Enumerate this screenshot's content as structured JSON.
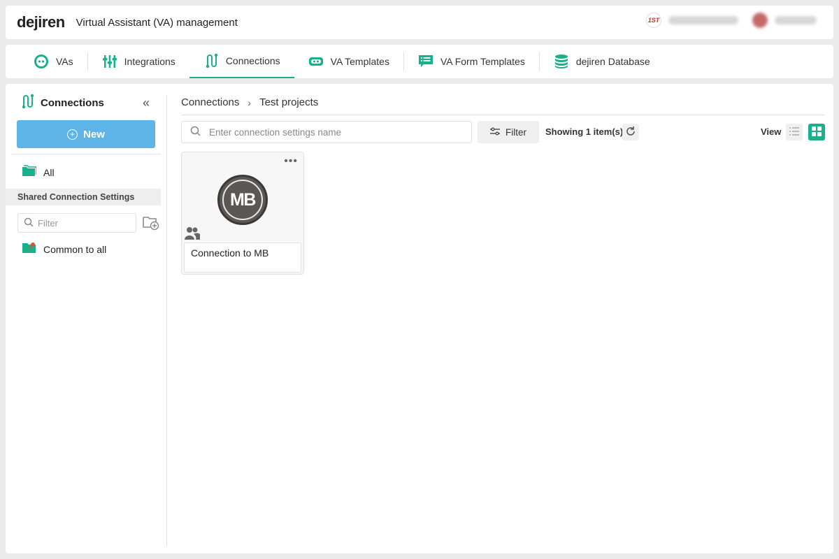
{
  "header": {
    "logo": "dejiren",
    "title": "Virtual Assistant (VA) management",
    "org_badge": "1ST"
  },
  "nav": {
    "tabs": [
      {
        "label": "VAs",
        "icon": "robot-icon"
      },
      {
        "label": "Integrations",
        "icon": "integrations-icon"
      },
      {
        "label": "Connections",
        "icon": "connections-icon",
        "active": true
      },
      {
        "label": "VA Templates",
        "icon": "va-template-icon"
      },
      {
        "label": "VA Form Templates",
        "icon": "form-template-icon"
      },
      {
        "label": "dejiren Database",
        "icon": "database-icon"
      }
    ]
  },
  "sidebar": {
    "title": "Connections",
    "new_label": "New",
    "all_label": "All",
    "shared_header": "Shared Connection Settings",
    "filter_placeholder": "Filter",
    "common_label": "Common to all"
  },
  "content": {
    "breadcrumb": [
      "Connections",
      "Test projects"
    ],
    "search_placeholder": "Enter connection settings name",
    "filter_label": "Filter",
    "showing": "Showing 1 item(s)",
    "view_label": "View",
    "cards": [
      {
        "name": "Connection to MB",
        "avatar_text": "MB"
      }
    ]
  },
  "colors": {
    "accent": "#19b08c",
    "new_button": "#5eb4e6",
    "avatar_bg": "#5a5756"
  }
}
